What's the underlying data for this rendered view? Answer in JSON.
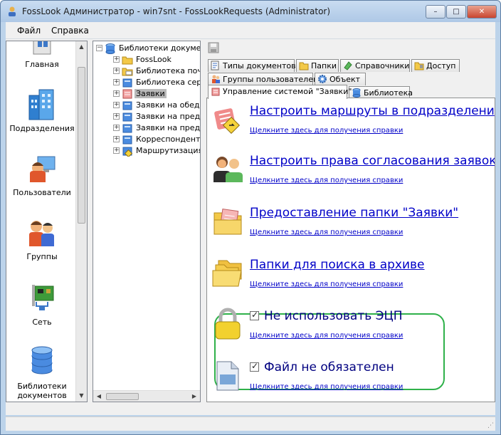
{
  "window": {
    "title": "FossLook Администратор - win7snt - FossLookRequests (Administrator)",
    "controls": [
      "minimize",
      "maximize",
      "close"
    ]
  },
  "menu": [
    "Файл",
    "Справка"
  ],
  "nav": {
    "items": [
      {
        "label": "Главная",
        "icon": "home-icon"
      },
      {
        "label": "Подразделения",
        "icon": "buildings-icon"
      },
      {
        "label": "Пользователи",
        "icon": "user-computer-icon"
      },
      {
        "label": "Группы",
        "icon": "users-group-icon"
      },
      {
        "label": "Сеть",
        "icon": "network-card-icon"
      },
      {
        "label": "Библиотеки документов",
        "icon": "database-icon"
      }
    ]
  },
  "tree": {
    "root": "Библиотеки документов",
    "children": [
      {
        "label": "FossLook",
        "icon": "folder-icon"
      },
      {
        "label": "Библиотека почт",
        "icon": "mail-folder-icon"
      },
      {
        "label": "Библиотека серв",
        "icon": "library-icon"
      },
      {
        "label": "Заявки",
        "icon": "requests-icon",
        "selected": true
      },
      {
        "label": "Заявки на обед",
        "icon": "library-icon"
      },
      {
        "label": "Заявки на предс",
        "icon": "library-icon"
      },
      {
        "label": "Заявки на предс",
        "icon": "library-icon"
      },
      {
        "label": "Корреспонденть",
        "icon": "library-icon"
      },
      {
        "label": "Маршрутизация",
        "icon": "route-icon"
      }
    ]
  },
  "tabs": {
    "row1": [
      "Типы документов",
      "Папки",
      "Справочники",
      "Доступ"
    ],
    "row2": [
      "Группы пользователей",
      "Объект"
    ],
    "row3": [
      "Управление системой \"Заявки\"",
      "Библиотека"
    ],
    "active": "Управление системой \"Заявки\""
  },
  "tasks": [
    {
      "title": "Настроить маршруты в подразделени",
      "help": "Щелкните здесь для получения справки",
      "icon": "route-sign-icon"
    },
    {
      "title": "Настроить права согласования заявок",
      "help": "Щелкните здесь для получения справки",
      "icon": "users-rights-icon"
    },
    {
      "title": "Предоставление папки \"Заявки\"",
      "help": "Щелкните здесь для получения справки",
      "icon": "folder-doc-icon"
    },
    {
      "title": "Папки для поиска в архиве",
      "help": "Щелкните здесь для получения справки",
      "icon": "folders-icon"
    },
    {
      "title": "Не использовать ЭЦП",
      "help": "Щелкните здесь для получения справки",
      "icon": "lock-icon",
      "checked": true
    },
    {
      "title": "Файл не обязателен",
      "help": "Щелкните здесь для получения справки",
      "icon": "document-icon",
      "checked": true
    }
  ],
  "colors": {
    "link": "#0000c8",
    "highlight_border": "#2fb14a",
    "selection": "#b9b9b9"
  }
}
